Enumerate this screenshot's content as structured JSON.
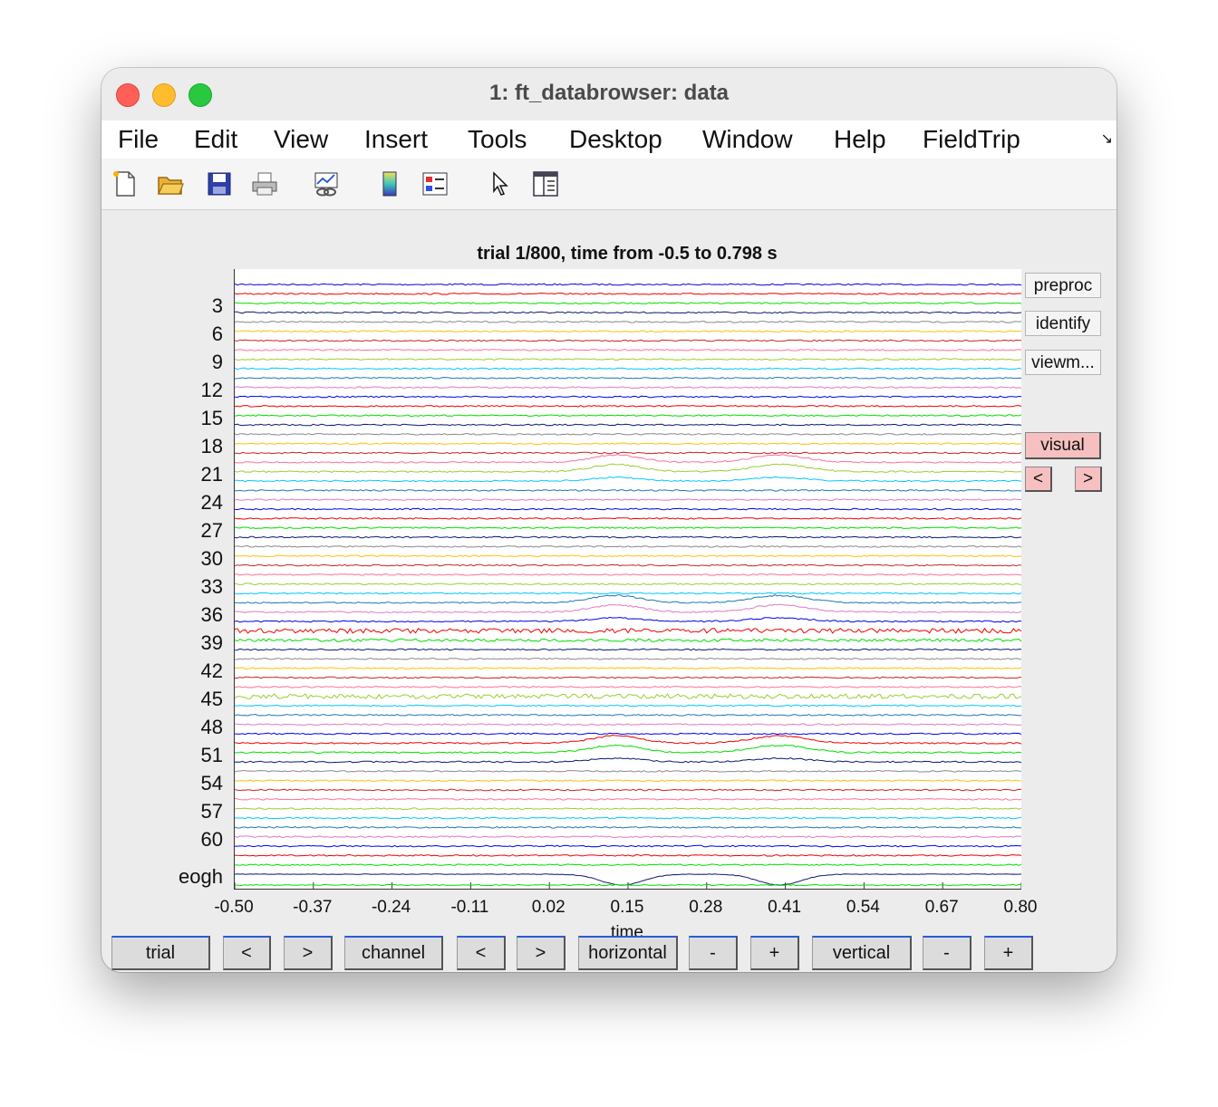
{
  "window": {
    "title": "1: ft_databrowser: data"
  },
  "menubar": {
    "items": [
      "File",
      "Edit",
      "View",
      "Insert",
      "Tools",
      "Desktop",
      "Window",
      "Help",
      "FieldTrip"
    ]
  },
  "toolbar": {
    "icons": [
      "new-file-icon",
      "open-folder-icon",
      "save-icon",
      "print-icon",
      "link-plot-icon",
      "colorbar-icon",
      "legend-icon",
      "pointer-icon",
      "property-inspector-icon"
    ]
  },
  "plot": {
    "title": "trial 1/800, time from -0.5 to 0.798 s",
    "xlabel": "time",
    "xticks": [
      "-0.50",
      "-0.37",
      "-0.24",
      "-0.11",
      "0.02",
      "0.15",
      "0.28",
      "0.41",
      "0.54",
      "0.67",
      "0.80"
    ],
    "yticks": [
      "3",
      "6",
      "9",
      "12",
      "15",
      "18",
      "21",
      "24",
      "27",
      "30",
      "33",
      "36",
      "39",
      "42",
      "45",
      "48",
      "51",
      "54",
      "57",
      "60",
      "eogh"
    ]
  },
  "chart_data": {
    "type": "line",
    "title": "trial 1/800, time from -0.5 to 0.798 s",
    "xlabel": "time",
    "ylabel": "",
    "xlim": [
      -0.5,
      0.8
    ],
    "n_traces": 64,
    "trace_colors": [
      "#0000ee",
      "#ee0000",
      "#00dd00",
      "#0a1a6e",
      "#888888",
      "#ffbf00",
      "#cc2020",
      "#ff6fa0",
      "#9acd32",
      "#00c8ff",
      "#1f77b4",
      "#e377c2"
    ],
    "annotation": {
      "label": "visual"
    }
  },
  "side_buttons": {
    "preproc": "preproc",
    "identify": "identify",
    "viewmode": "viewm...",
    "visual": "visual",
    "prev": "<",
    "next": ">"
  },
  "bottom_buttons": {
    "trial": "trial",
    "trial_prev": "<",
    "trial_next": ">",
    "channel": "channel",
    "channel_prev": "<",
    "channel_next": ">",
    "horizontal": "horizontal",
    "horizontal_minus": "-",
    "horizontal_plus": "+",
    "vertical": "vertical",
    "vertical_minus": "-",
    "vertical_plus": "+"
  }
}
